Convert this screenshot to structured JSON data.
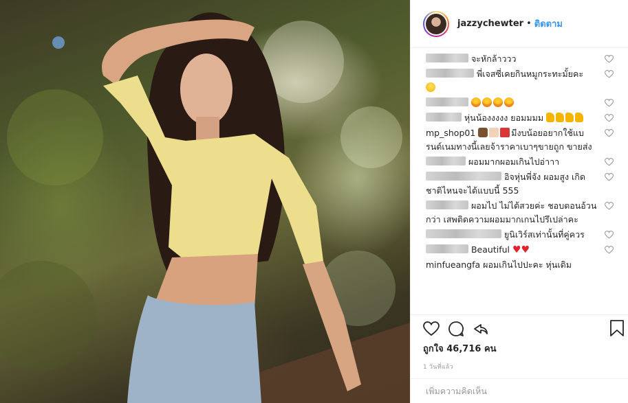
{
  "post": {
    "image_alt": "photo"
  },
  "header": {
    "username": "jazzychewter",
    "separator": "•",
    "follow_label": "ติดตาม"
  },
  "comments": [
    {
      "user": "",
      "text": "จะหักล้าววว",
      "emojis": []
    },
    {
      "user": "",
      "text": "พี่เจสซี่เคยกินหมูกระทะมั้ยคะ",
      "emojis": [
        "laugh"
      ]
    },
    {
      "user": "",
      "text": "",
      "emojis": [
        "star",
        "star",
        "star",
        "star"
      ]
    },
    {
      "user": "",
      "text": "หุ่นน้องงงงง ยอมมมม",
      "emojis": [
        "thumb",
        "thumb",
        "thumb",
        "thumb"
      ]
    },
    {
      "user": "mp_shop01",
      "text": "มีงบน้อยอยากใช้แบรนด์เนมทางนี้เลยจ้าราคาเบาๆขายถูก ขายส่ง",
      "emojis": [
        "bag",
        "box",
        "gift"
      ]
    },
    {
      "user": "",
      "text": "ผอมมากผอมเกินไปอ่าาา",
      "emojis": []
    },
    {
      "user": "",
      "text": "อิจหุ่นพี่จัง ผอมสูง เกิดชาติไหนจะได้แบบนี้ 555",
      "emojis": []
    },
    {
      "user": "",
      "text": "ผอมไป ไม่ได้สวยค่ะ ชอบตอนอ้วนกว่า เสพติดความผอมมากเกนไปรึเปล่าคะ",
      "emojis": []
    },
    {
      "user": "",
      "text": "ยูนิเวิร์สเท่านั้นที่คู่ควร",
      "emojis": []
    },
    {
      "user": "",
      "text": "Beautiful",
      "emojis": [
        "heart",
        "heart"
      ]
    },
    {
      "user": "minfueangfa",
      "text": "ผอมเกินไปปะคะ หุ่นเดิม",
      "emojis": []
    }
  ],
  "likes": {
    "prefix": "ถูกใจ",
    "count": "46,716",
    "suffix": "คน"
  },
  "timestamp": "1 วันที่แล้ว",
  "add_comment": {
    "placeholder": "เพิ่มความคิดเห็น"
  },
  "colors": {
    "accent": "#3897f0",
    "border": "#efefef",
    "muted": "#999999"
  },
  "icons": [
    "heart-icon",
    "comment-icon",
    "share-icon",
    "bookmark-icon"
  ]
}
